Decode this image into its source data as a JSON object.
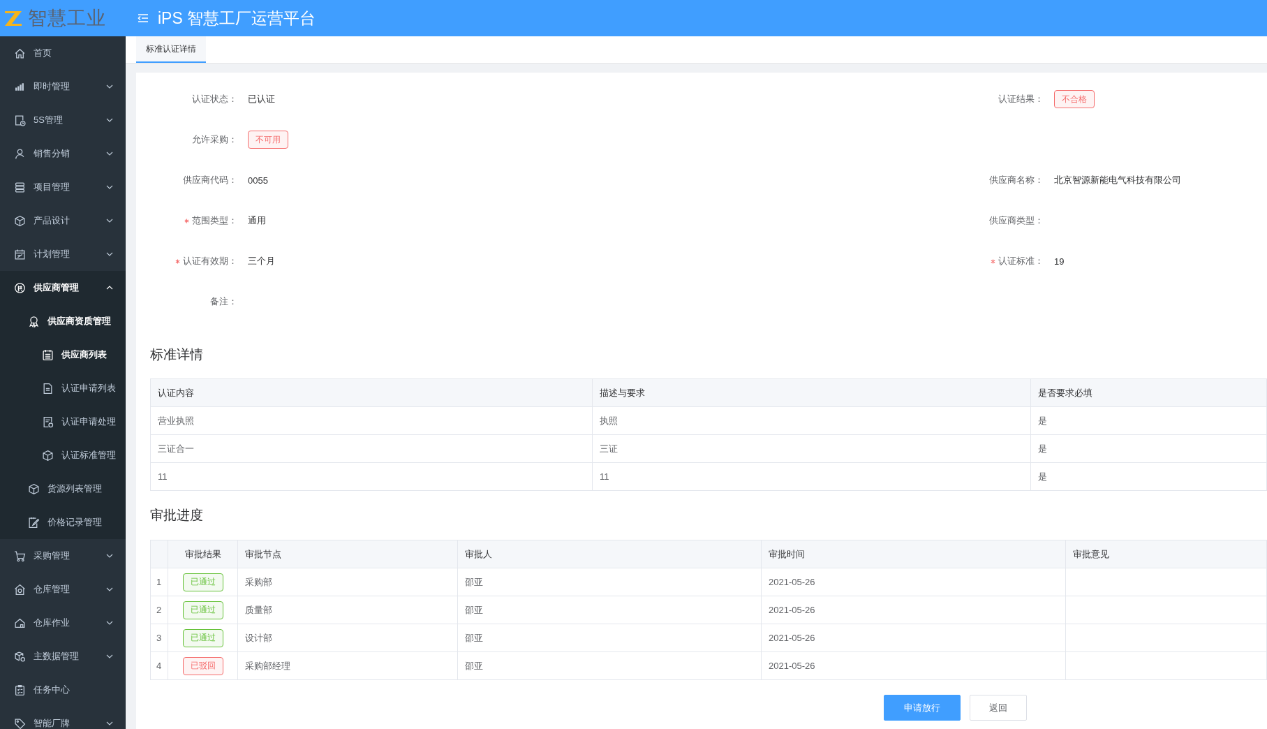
{
  "header": {
    "logo_text": "智慧工业",
    "title": "iPS 智慧工厂运营平台"
  },
  "sidebar": {
    "items": [
      {
        "label": "首页",
        "selected": false
      },
      {
        "label": "即时管理",
        "selected": false,
        "expanded": false
      },
      {
        "label": "5S管理",
        "selected": false,
        "expanded": false
      },
      {
        "label": "销售分销",
        "selected": false,
        "expanded": false
      },
      {
        "label": "项目管理",
        "selected": false,
        "expanded": false
      },
      {
        "label": "产品设计",
        "selected": false,
        "expanded": false
      },
      {
        "label": "计划管理",
        "selected": false,
        "expanded": false
      },
      {
        "label": "供应商管理",
        "selected": true,
        "expanded": true,
        "children": [
          {
            "label": "供应商资质管理",
            "selected": true,
            "expanded": true,
            "children": [
              {
                "label": "供应商列表",
                "selected": true
              },
              {
                "label": "认证申请列表",
                "selected": false
              },
              {
                "label": "认证申请处理",
                "selected": false
              },
              {
                "label": "认证标准管理",
                "selected": false
              }
            ]
          },
          {
            "label": "货源列表管理",
            "selected": false
          },
          {
            "label": "价格记录管理",
            "selected": false
          }
        ]
      },
      {
        "label": "采购管理",
        "selected": false,
        "expanded": false
      },
      {
        "label": "仓库管理",
        "selected": false,
        "expanded": false
      },
      {
        "label": "仓库作业",
        "selected": false,
        "expanded": false
      },
      {
        "label": "主数据管理",
        "selected": false,
        "expanded": false
      },
      {
        "label": "任务中心",
        "selected": false
      },
      {
        "label": "智能厂牌",
        "selected": false,
        "expanded": false
      }
    ]
  },
  "tabs": [
    {
      "label": "标准认证详情",
      "selected": true
    }
  ],
  "form": {
    "rows": [
      {
        "fields": [
          {
            "label": "认证状态：",
            "value": "已认证",
            "required": false,
            "kind": "text"
          },
          {
            "label": "认证结果：",
            "value": "不合格",
            "required": false,
            "kind": "tag",
            "color": "#f56c6c"
          }
        ]
      },
      {
        "fields": [
          {
            "label": "允许采购：",
            "value": "不可用",
            "required": false,
            "kind": "tag",
            "color": "#f56c6c"
          }
        ]
      },
      {
        "fields": [
          {
            "label": "供应商代码：",
            "value": "0055",
            "required": false,
            "kind": "text"
          },
          {
            "label": "供应商名称：",
            "value": "北京智源新能电气科技有限公司",
            "required": false,
            "kind": "text"
          }
        ]
      },
      {
        "fields": [
          {
            "label": "范围类型：",
            "value": "通用",
            "required": true,
            "kind": "text"
          },
          {
            "label": "供应商类型：",
            "required": false,
            "kind": "text"
          }
        ]
      },
      {
        "fields": [
          {
            "label": "认证有效期：",
            "value": "三个月",
            "required": true,
            "kind": "text"
          },
          {
            "label": "认证标准：",
            "value": "19",
            "required": true,
            "kind": "text"
          }
        ]
      },
      {
        "fields": [
          {
            "label": "备注：",
            "required": false,
            "kind": "text"
          }
        ]
      }
    ]
  },
  "standard_table": {
    "title": "标准详情",
    "columns": [
      "认证内容",
      "描述与要求",
      "是否要求必填"
    ],
    "rows": [
      [
        "营业执照",
        "执照",
        "是"
      ],
      [
        "三证合一",
        "三证",
        "是"
      ],
      [
        "11",
        "11",
        "是"
      ]
    ]
  },
  "approval_table": {
    "title": "审批进度",
    "columns": [
      "审批结果",
      "审批节点",
      "审批人",
      "审批时间",
      "审批意见"
    ],
    "rows": [
      {
        "index": "1",
        "result": {
          "label": "已通过",
          "color": "#67c23a"
        },
        "node": "采购部",
        "approver": "邵亚",
        "time": "2021-05-26"
      },
      {
        "index": "2",
        "result": {
          "label": "已通过",
          "color": "#67c23a"
        },
        "node": "质量部",
        "approver": "邵亚",
        "time": "2021-05-26"
      },
      {
        "index": "3",
        "result": {
          "label": "已通过",
          "color": "#67c23a"
        },
        "node": "设计部",
        "approver": "邵亚",
        "time": "2021-05-26"
      },
      {
        "index": "4",
        "result": {
          "label": "已驳回",
          "color": "#f56c6c"
        },
        "node": "采购部经理",
        "approver": "邵亚",
        "time": "2021-05-26"
      }
    ]
  },
  "buttons": [
    {
      "label": "申请放行",
      "kind": "primary"
    },
    {
      "label": "返回",
      "kind": "default"
    }
  ]
}
